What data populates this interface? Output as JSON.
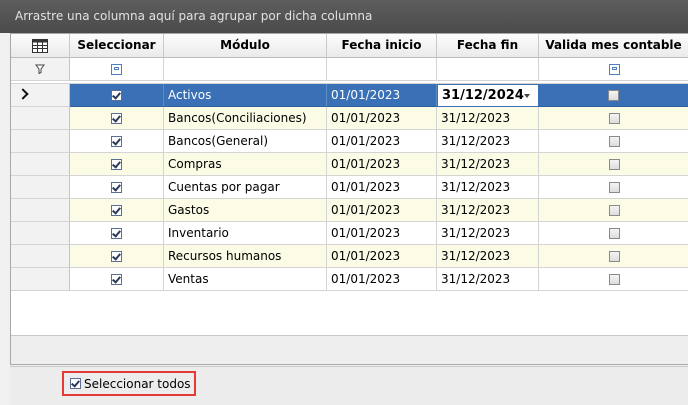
{
  "group_panel_text": "Arrastre una columna aquí para agrupar por dicha columna",
  "columns": {
    "chooser_icon": "column-chooser-icon",
    "seleccionar": "Seleccionar",
    "modulo": "Módulo",
    "fecha_inicio": "Fecha inicio",
    "fecha_fin": "Fecha fin",
    "valida": "Valida mes contable"
  },
  "rows": [
    {
      "selected": true,
      "modulo": "Activos",
      "fecha_inicio": "01/01/2023",
      "fecha_fin": "31/12/2024",
      "valida": false
    },
    {
      "selected": true,
      "modulo": "Bancos(Conciliaciones)",
      "fecha_inicio": "01/01/2023",
      "fecha_fin": "31/12/2023",
      "valida": false
    },
    {
      "selected": true,
      "modulo": "Bancos(General)",
      "fecha_inicio": "01/01/2023",
      "fecha_fin": "31/12/2023",
      "valida": false
    },
    {
      "selected": true,
      "modulo": "Compras",
      "fecha_inicio": "01/01/2023",
      "fecha_fin": "31/12/2023",
      "valida": false
    },
    {
      "selected": true,
      "modulo": "Cuentas por pagar",
      "fecha_inicio": "01/01/2023",
      "fecha_fin": "31/12/2023",
      "valida": false
    },
    {
      "selected": true,
      "modulo": "Gastos",
      "fecha_inicio": "01/01/2023",
      "fecha_fin": "31/12/2023",
      "valida": false
    },
    {
      "selected": true,
      "modulo": "Inventario",
      "fecha_inicio": "01/01/2023",
      "fecha_fin": "31/12/2023",
      "valida": false
    },
    {
      "selected": true,
      "modulo": "Recursos humanos",
      "fecha_inicio": "01/01/2023",
      "fecha_fin": "31/12/2023",
      "valida": false
    },
    {
      "selected": true,
      "modulo": "Ventas",
      "fecha_inicio": "01/01/2023",
      "fecha_fin": "31/12/2023",
      "valida": false
    }
  ],
  "footer": {
    "select_all_label": "Seleccionar todos",
    "select_all_checked": true
  },
  "colors": {
    "selected_row": "#3a70b5",
    "alt_row": "#fbfbe6",
    "highlight_border": "#e53935"
  }
}
